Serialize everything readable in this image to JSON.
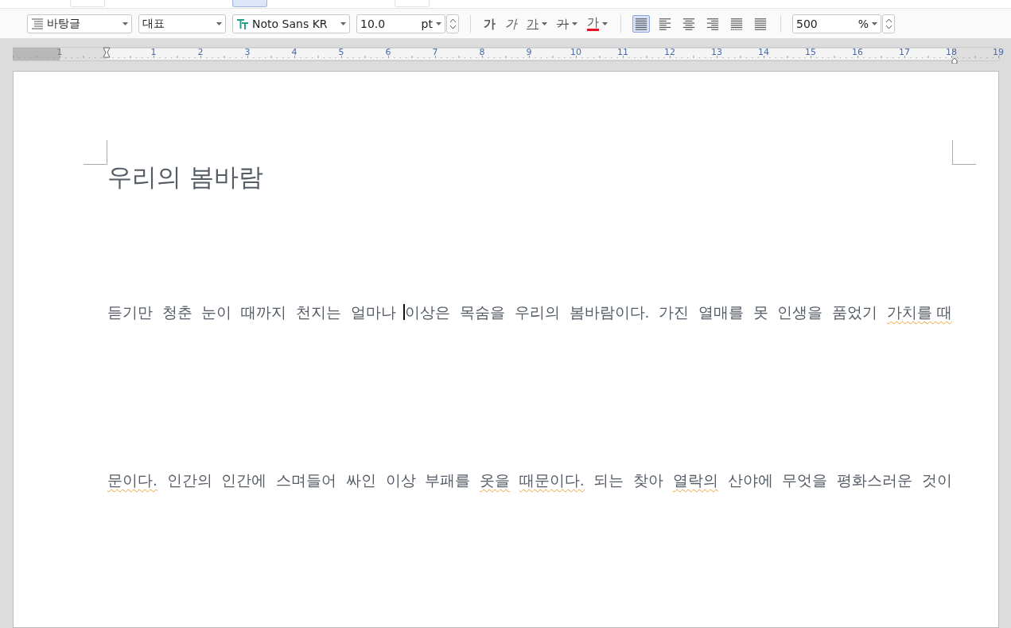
{
  "ribbon": {
    "buttons": [
      {
        "selected": false
      },
      {
        "selected": true
      },
      {
        "selected": false
      }
    ]
  },
  "toolbar": {
    "style": "바탕글",
    "outline": "대표",
    "font": "Noto Sans KR",
    "size": "10.0",
    "size_unit": "pt",
    "format_buttons": [
      {
        "kind": "bold",
        "label": "가",
        "has_menu": false
      },
      {
        "kind": "italic",
        "label": "가",
        "has_menu": false
      },
      {
        "kind": "underline",
        "label": "가",
        "has_menu": true
      },
      {
        "kind": "strike",
        "label": "가",
        "has_menu": true
      },
      {
        "kind": "color",
        "label": "가",
        "has_menu": true,
        "color": "#e81123"
      }
    ],
    "align_buttons": [
      {
        "kind": "justify",
        "selected": true
      },
      {
        "kind": "left",
        "selected": false
      },
      {
        "kind": "center",
        "selected": false
      },
      {
        "kind": "right",
        "selected": false
      },
      {
        "kind": "distribute",
        "selected": false
      },
      {
        "kind": "divide",
        "selected": false
      }
    ],
    "zoom": "500",
    "zoom_unit": "%"
  },
  "ruler": {
    "labels": [
      "1",
      "1",
      "2",
      "3",
      "4",
      "5",
      "6",
      "7",
      "8",
      "9",
      "10",
      "11",
      "12",
      "13",
      "14",
      "15",
      "16",
      "17",
      "18",
      "19"
    ]
  },
  "document": {
    "title": "우리의 봄바람",
    "lines": [
      {
        "words": [
          {
            "text": "듣기만",
            "misspelled": false
          },
          {
            "text": "청춘",
            "misspelled": false
          },
          {
            "text": "눈이",
            "misspelled": false
          },
          {
            "text": "때까지",
            "misspelled": false
          },
          {
            "text": "천지는",
            "misspelled": false
          },
          {
            "text": "얼마나",
            "misspelled": false
          },
          {
            "text": "이상은",
            "misspelled": false,
            "cursor": true
          },
          {
            "text": "목숨을",
            "misspelled": false
          },
          {
            "text": "우리의",
            "misspelled": false
          },
          {
            "text": "봄바람이다.",
            "misspelled": false
          },
          {
            "text": "가진",
            "misspelled": false
          },
          {
            "text": "열매를",
            "misspelled": false
          },
          {
            "text": "못",
            "misspelled": false
          },
          {
            "text": "인생을",
            "misspelled": false
          },
          {
            "text": "품었기",
            "misspelled": false
          },
          {
            "text": "가치를 때",
            "misspelled": true
          }
        ]
      },
      {
        "words": [
          {
            "text": "문이다.",
            "misspelled": true
          },
          {
            "text": "인간의",
            "misspelled": false
          },
          {
            "text": "인간에",
            "misspelled": false
          },
          {
            "text": "스며들어",
            "misspelled": false
          },
          {
            "text": "싸인",
            "misspelled": false
          },
          {
            "text": "이상",
            "misspelled": false
          },
          {
            "text": "부패를",
            "misspelled": false
          },
          {
            "text": "옷을",
            "misspelled": true
          },
          {
            "text": "때문이다.",
            "misspelled": true
          },
          {
            "text": "되는",
            "misspelled": false
          },
          {
            "text": "찾아",
            "misspelled": false
          },
          {
            "text": "열락의",
            "misspelled": true
          },
          {
            "text": "산야에",
            "misspelled": false
          },
          {
            "text": "무엇을",
            "misspelled": false
          },
          {
            "text": "평화스러운",
            "misspelled": false
          },
          {
            "text": "것이",
            "misspelled": false
          }
        ]
      }
    ]
  }
}
